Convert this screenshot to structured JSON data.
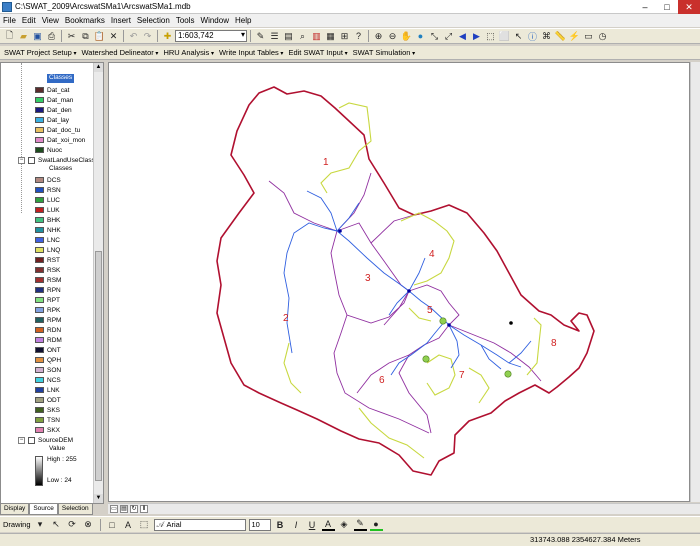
{
  "window": {
    "title": "C:\\SWAT_2009\\ArcswatSMa1\\ArcswatSMa1.mdb"
  },
  "menu": [
    "File",
    "Edit",
    "View",
    "Bookmarks",
    "Insert",
    "Selection",
    "Tools",
    "Window",
    "Help"
  ],
  "standard_toolbar": {
    "scale": "1:603,742"
  },
  "swat_toolbar": [
    "SWAT Project Setup",
    "Watershed Delineator",
    "HRU Analysis",
    "Write Input Tables",
    "Edit SWAT Input",
    "SWAT Simulation"
  ],
  "toc": {
    "classes_header": "Classes",
    "soil_classes": [
      {
        "label": "Dat_cat",
        "color": "#5a2c2c"
      },
      {
        "label": "Dat_man",
        "color": "#33cc66"
      },
      {
        "label": "Dat_den",
        "color": "#1a1a80"
      },
      {
        "label": "Dat_lay",
        "color": "#3ab0e0"
      },
      {
        "label": "Dat_doc_tu",
        "color": "#e8c060"
      },
      {
        "label": "Dat_xoi_mon",
        "color": "#e088c8"
      },
      {
        "label": "Nuoc",
        "color": "#1f4d1f"
      }
    ],
    "landuse_layer": "SwatLandUseClass(",
    "landuse_header": "Classes",
    "landuse_classes": [
      {
        "label": "DCS",
        "color": "#b08880"
      },
      {
        "label": "RSN",
        "color": "#2050c0"
      },
      {
        "label": "LUC",
        "color": "#30a040"
      },
      {
        "label": "LUK",
        "color": "#c02020"
      },
      {
        "label": "BHK",
        "color": "#40c080"
      },
      {
        "label": "NHK",
        "color": "#2090a0"
      },
      {
        "label": "LNC",
        "color": "#4060e0"
      },
      {
        "label": "LNQ",
        "color": "#e0e060"
      },
      {
        "label": "RST",
        "color": "#702020"
      },
      {
        "label": "RSK",
        "color": "#803030"
      },
      {
        "label": "RSM",
        "color": "#a03030"
      },
      {
        "label": "RPN",
        "color": "#203080"
      },
      {
        "label": "RPT",
        "color": "#80e080"
      },
      {
        "label": "RPK",
        "color": "#80a0e0"
      },
      {
        "label": "RPM",
        "color": "#206060"
      },
      {
        "label": "RDN",
        "color": "#d06020"
      },
      {
        "label": "RDM",
        "color": "#c080e0"
      },
      {
        "label": "ONT",
        "color": "#101030"
      },
      {
        "label": "QPH",
        "color": "#e09040"
      },
      {
        "label": "SON",
        "color": "#d0b0d0"
      },
      {
        "label": "NCS",
        "color": "#40d0e0"
      },
      {
        "label": "LNK",
        "color": "#2040a0"
      },
      {
        "label": "ODT",
        "color": "#a0a080"
      },
      {
        "label": "SKS",
        "color": "#406020"
      },
      {
        "label": "TSN",
        "color": "#80a040"
      },
      {
        "label": "SKX",
        "color": "#e080b0"
      }
    ],
    "dem_layer": "SourceDEM",
    "dem_value": "Value",
    "dem_high": "High : 255",
    "dem_low": "Low : 24"
  },
  "tabs": [
    "Display",
    "Source",
    "Selection"
  ],
  "map": {
    "subbasins": [
      "1",
      "2",
      "3",
      "4",
      "5",
      "6",
      "7",
      "8"
    ],
    "boundary_color": "#b01030",
    "subbasin_color": "#9030a0",
    "stream_color": "#3060e0",
    "landuse_line_color": "#c8d840"
  },
  "drawing_toolbar": {
    "label": "Drawing",
    "font": "Arial",
    "size": "10"
  },
  "status": {
    "coords": "313743.088  2354627.384 Meters"
  }
}
